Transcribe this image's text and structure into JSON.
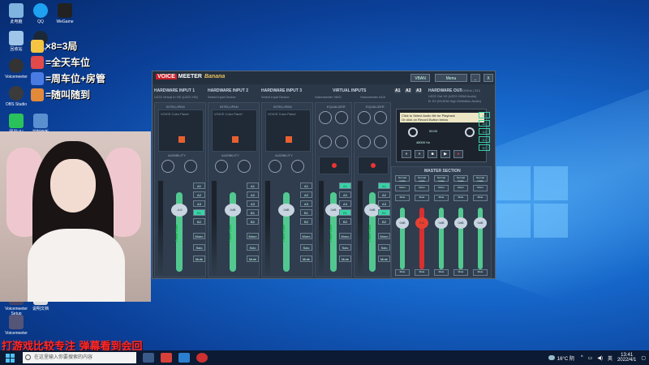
{
  "overlay": {
    "line1": "×8=3局",
    "line2": "=全天车位",
    "line3": "=周车位+房管",
    "line4": "=随叫随到",
    "caption": "打游戏比较专注 弹幕看到会回"
  },
  "desktop_icons": [
    {
      "label": "此电脑"
    },
    {
      "label": "QQ"
    },
    {
      "label": "WeGame"
    },
    {
      "label": "回收站"
    },
    {
      "label": "Steam"
    },
    {
      "label": "Voicemeeter"
    },
    {
      "label": "OBS Studio"
    },
    {
      "label": "网易UU"
    },
    {
      "label": "控制面板"
    },
    {
      "label": "Voicemeeter Setup"
    },
    {
      "label": "说明文档"
    },
    {
      "label": "Voicemeeter"
    }
  ],
  "voicemeeter": {
    "logo_a": "VOICE",
    "logo_b": "MEETER",
    "logo_c": "Banana",
    "vban_label": "VBAN",
    "menu_label": "Menu",
    "minimize": "_",
    "close": "X",
    "strips": [
      {
        "title": "HARDWARE INPUT 1",
        "device": "UZ22 Virtual In HD (UZ22 HD)",
        "label": "INTELLIPAN",
        "panel": "VOICE  Color Panel",
        "eq": "AUDIBILITY",
        "fader": "0dB",
        "fader_label": "Fader Gain"
      },
      {
        "title": "HARDWARE INPUT 2",
        "device": "Select Input Device",
        "label": "INTELLIPAN",
        "panel": "VOICE  Color Panel",
        "eq": "AUDIBILITY",
        "fader": "0dB",
        "fader_label": "Fader Gain"
      },
      {
        "title": "HARDWARE INPUT 3",
        "device": "Select Input Device",
        "label": "INTELLIPAN",
        "panel": "VOICE  Color Panel",
        "eq": "AUDIBILITY",
        "fader": "0dB",
        "fader_label": "Fader Gain"
      },
      {
        "title": "VIRTUAL INPUTS",
        "device": "Voicemeeter VAIO",
        "label": "EQUALIZER",
        "panel": "Treble",
        "eq": "Bass",
        "fader": "0dB",
        "fader_label": "Fader Gain"
      },
      {
        "title": "",
        "device": "Voicemeeter AUX",
        "label": "EQUALIZER",
        "panel": "Treble",
        "eq": "Bass",
        "fader": "0dB",
        "fader_label": "Fader Gain"
      }
    ],
    "strip1_fader": "-4.6",
    "route_buttons": [
      "A1",
      "A2",
      "A3",
      "B1",
      "B2"
    ],
    "mute": "Mute",
    "mono": "Mono",
    "solo": "Solo",
    "hardware_out": "HARDWARE OUT",
    "out_rate": "48000Hz | 512",
    "out_device1": "UZ22 Out V2 (UZ22 HDMI Audio)",
    "out_device2": "B: E2 (NVIDIA High Definition Audio)",
    "bus_a1": "A1",
    "bus_a2": "A2",
    "bus_a3": "A3",
    "tape_note1": "Click to Select Audio file for Playback",
    "tape_note2": "Or click on Record Button below",
    "tape_time": "00:00",
    "tape_rate": "48000 Hz",
    "master_title": "MASTER SECTION",
    "normal_mode": "Normal mode",
    "master_faders": [
      "0dB",
      "2.0",
      "0dB",
      "0dB",
      "0dB"
    ],
    "out_buttons": [
      "A1",
      "A2",
      "A3",
      "B1",
      "B2"
    ]
  },
  "taskbar": {
    "search_placeholder": "在这里输入你要搜索的内容",
    "weather": "16°C 阴",
    "lang": "英",
    "time": "13:41",
    "date": "2022/4/1"
  },
  "colors": {
    "accent": "#3ad2a8",
    "fader": "#52c890",
    "caption": "#ff2a2a"
  }
}
